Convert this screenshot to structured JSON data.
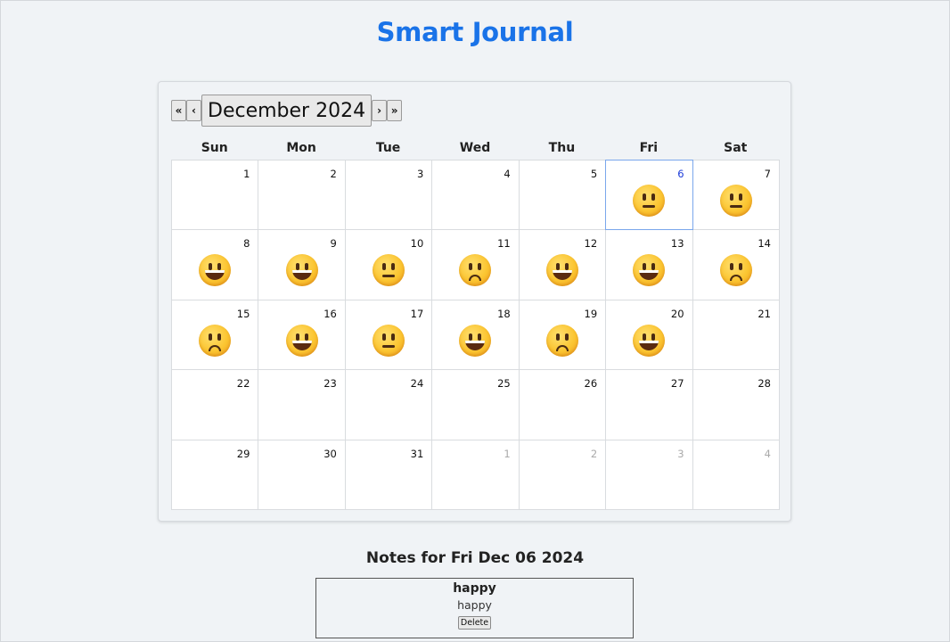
{
  "app": {
    "title": "Smart Journal"
  },
  "calendar": {
    "nav": {
      "prev_year": "«",
      "prev_month": "‹",
      "month_label": "December 2024",
      "next_month": "›",
      "next_year": "»"
    },
    "weekdays": [
      "Sun",
      "Mon",
      "Tue",
      "Wed",
      "Thu",
      "Fri",
      "Sat"
    ],
    "selected_day": "6",
    "days": [
      {
        "num": "1",
        "mood": null,
        "current": true
      },
      {
        "num": "2",
        "mood": null,
        "current": true
      },
      {
        "num": "3",
        "mood": null,
        "current": true
      },
      {
        "num": "4",
        "mood": null,
        "current": true
      },
      {
        "num": "5",
        "mood": null,
        "current": true
      },
      {
        "num": "6",
        "mood": "neutral",
        "current": true
      },
      {
        "num": "7",
        "mood": "neutral",
        "current": true
      },
      {
        "num": "8",
        "mood": "happy",
        "current": true
      },
      {
        "num": "9",
        "mood": "happy",
        "current": true
      },
      {
        "num": "10",
        "mood": "neutral",
        "current": true
      },
      {
        "num": "11",
        "mood": "sad",
        "current": true
      },
      {
        "num": "12",
        "mood": "happy",
        "current": true
      },
      {
        "num": "13",
        "mood": "happy",
        "current": true
      },
      {
        "num": "14",
        "mood": "sad",
        "current": true
      },
      {
        "num": "15",
        "mood": "sad",
        "current": true
      },
      {
        "num": "16",
        "mood": "happy",
        "current": true
      },
      {
        "num": "17",
        "mood": "neutral",
        "current": true
      },
      {
        "num": "18",
        "mood": "happy",
        "current": true
      },
      {
        "num": "19",
        "mood": "sad",
        "current": true
      },
      {
        "num": "20",
        "mood": "happy",
        "current": true
      },
      {
        "num": "21",
        "mood": null,
        "current": true
      },
      {
        "num": "22",
        "mood": null,
        "current": true
      },
      {
        "num": "23",
        "mood": null,
        "current": true
      },
      {
        "num": "24",
        "mood": null,
        "current": true
      },
      {
        "num": "25",
        "mood": null,
        "current": true
      },
      {
        "num": "26",
        "mood": null,
        "current": true
      },
      {
        "num": "27",
        "mood": null,
        "current": true
      },
      {
        "num": "28",
        "mood": null,
        "current": true
      },
      {
        "num": "29",
        "mood": null,
        "current": true
      },
      {
        "num": "30",
        "mood": null,
        "current": true
      },
      {
        "num": "31",
        "mood": null,
        "current": true
      },
      {
        "num": "1",
        "mood": null,
        "current": false
      },
      {
        "num": "2",
        "mood": null,
        "current": false
      },
      {
        "num": "3",
        "mood": null,
        "current": false
      },
      {
        "num": "4",
        "mood": null,
        "current": false
      }
    ]
  },
  "notes": {
    "heading": "Notes for Fri Dec 06 2024",
    "items": [
      {
        "title": "happy",
        "body": "happy",
        "delete_label": "Delete"
      }
    ]
  },
  "colors": {
    "accent": "#1a73e8",
    "selected_border": "#7aa7ec",
    "selected_day_number": "#1a3ad8"
  }
}
